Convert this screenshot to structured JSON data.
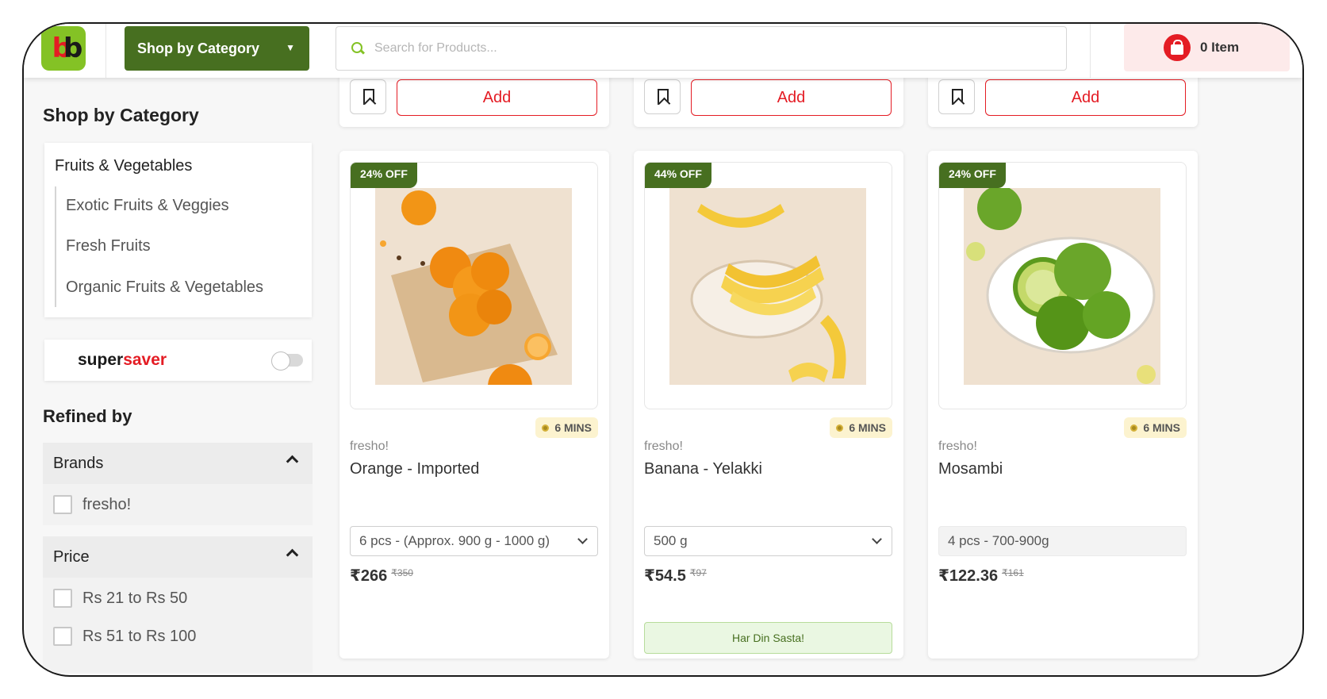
{
  "header": {
    "logo_text": "bb",
    "shop_by_category_label": "Shop by Category",
    "search_placeholder": "Search for Products...",
    "cart_label": "0 Item"
  },
  "sidebar": {
    "heading": "Shop by Category",
    "category": {
      "main": "Fruits & Vegetables",
      "subs": [
        "Exotic Fruits & Veggies",
        "Fresh Fruits",
        "Organic Fruits & Vegetables"
      ]
    },
    "supersaver": {
      "part1": "super",
      "part2": "saver",
      "enabled": false
    },
    "refined_by": "Refined by",
    "filters": {
      "brands": {
        "title": "Brands",
        "options": [
          "fresho!"
        ]
      },
      "price": {
        "title": "Price",
        "options": [
          "Rs 21 to Rs 50",
          "Rs 51 to Rs 100"
        ]
      }
    }
  },
  "top_row": {
    "add_label": "Add"
  },
  "products": [
    {
      "discount": "24% OFF",
      "delivery": "6 MINS",
      "brand": "fresho!",
      "name": "Orange - Imported",
      "pack": "6 pcs - (Approx. 900 g - 1000 g)",
      "price": "₹266",
      "mrp": "₹350",
      "image": "oranges-on-board"
    },
    {
      "discount": "44% OFF",
      "delivery": "6 MINS",
      "brand": "fresho!",
      "name": "Banana - Yelakki",
      "pack": "500 g",
      "price": "₹54.5",
      "mrp": "₹97",
      "image": "bananas-on-plate",
      "extra_button": "Har Din Sasta!"
    },
    {
      "discount": "24% OFF",
      "delivery": "6 MINS",
      "brand": "fresho!",
      "name": "Mosambi",
      "pack": "4 pcs - 700-900g",
      "price": "₹122.36",
      "mrp": "₹161",
      "image": "mosambi-in-bowl"
    }
  ],
  "colors": {
    "brand_green": "#84c225",
    "dark_green": "#476f20",
    "accent_red": "#e41c24"
  }
}
